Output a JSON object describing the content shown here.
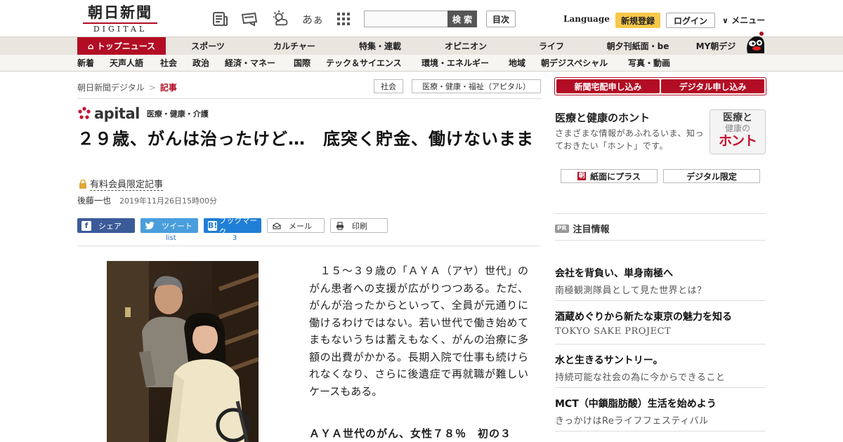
{
  "header": {
    "logo_jp": "朝日新聞",
    "logo_en": "DIGITAL",
    "font_label": "あぁ",
    "search_placeholder": "",
    "search_button": "検 索",
    "index_button": "目次",
    "language": "Language",
    "register": "新規登録",
    "login": "ログイン",
    "menu": "メニュー"
  },
  "nav_primary": [
    "トップニュース",
    "スポーツ",
    "カルチャー",
    "特集・連載",
    "オピニオン",
    "ライフ",
    "朝夕刊紙面・be",
    "MY朝デジ"
  ],
  "nav_secondary": [
    "新着",
    "天声人語",
    "社会",
    "政治",
    "経済・マネー",
    "国際",
    "テック＆サイエンス",
    "環境・エネルギー",
    "地域",
    "朝デジスペシャル",
    "写真・動画"
  ],
  "breadcrumb": {
    "home": "朝日新聞デジタル",
    "sep": ">",
    "current": "記事"
  },
  "tags": [
    "社会",
    "医療・健康・福祉（アピタル）"
  ],
  "article": {
    "brand": "apital",
    "brand_sub": "医療・健康・介護",
    "title": "２９歳、がんは治ったけど…　底突く貯金、働けないまま",
    "paid_label": "有料会員限定記事",
    "author": "後藤一也",
    "date": "2019年11月26日15時00分",
    "share": {
      "facebook": "シェア",
      "twitter": "ツイート",
      "hatena": "ブックマーク",
      "mail": "メール",
      "print": "印刷",
      "twitter_count": "list",
      "hatena_count": "3"
    },
    "body": "　１５～３９歳の「ＡＹＡ（アヤ）世代」のがん患者への支援が広がりつつある。ただ、がんが治ったからといって、全員が元通りに働けるわけではない。若い世代で働き始めてまもないうちは蓄えもなく、がんの治療に多額の出費がかかる。長期入院で仕事も続けられなくなり、さらに後遺症で再就職が難しいケースもある。",
    "subhead": "ＡＹＡ世代のがん、女性７８％　初の３"
  },
  "sidebar": {
    "subscribe_paper": "新聞宅配申し込み",
    "subscribe_digital": "デジタル申し込み",
    "honto_title": "医療と健康のホント",
    "honto_desc": "さまざまな情報があふれるいま、知っておきたい「ホント」です。",
    "honto_logo_1": "医療と",
    "honto_logo_2": "健康の",
    "honto_logo_3": "ホント",
    "paper_plus": "紙面にプラス",
    "paper_icon": "朝",
    "digital_only": "デジタル限定",
    "pr_badge": "PR",
    "pr_title": "注目情報",
    "pr_items": [
      {
        "title": "会社を背負い、単身南極へ",
        "sub": "南極観測隊員として見た世界とは？"
      },
      {
        "title": "酒蔵めぐりから新たな東京の魅力を知る",
        "sub": "TOKYO SAKE PROJECT"
      },
      {
        "title": "水と生きるサントリー。",
        "sub": "持続可能な社会の為に今からできること"
      },
      {
        "title": "MCT（中鎖脂肪酸）生活を始めよう",
        "sub": "きっかけはReライフフェスティバル"
      }
    ]
  },
  "colors": {
    "brand_red": "#b20d24",
    "register_yellow": "#f7c84a",
    "facebook": "#3b5b98",
    "twitter": "#4a9edc",
    "hatena": "#1f7ed6"
  }
}
